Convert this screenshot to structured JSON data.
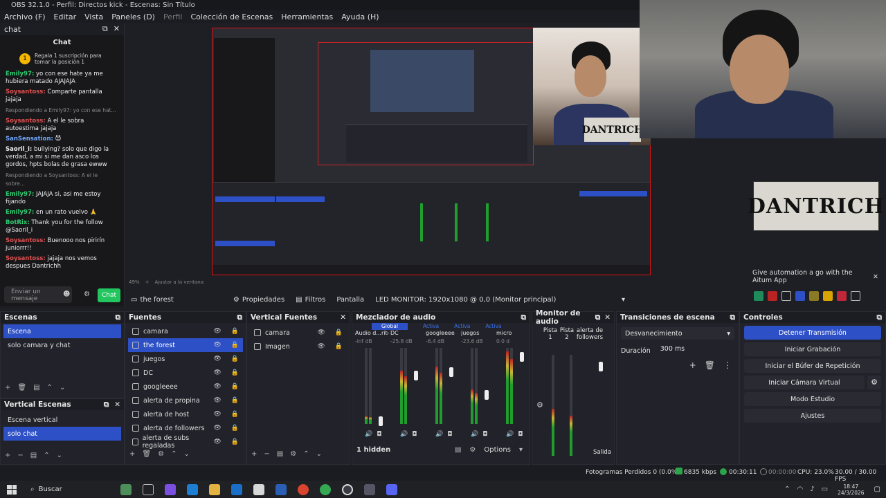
{
  "window": {
    "title": "OBS 32.1.0 - Perfil: Directos kick - Escenas: Sin Título",
    "menu": [
      "Archivo (F)",
      "Editar",
      "Vista",
      "Paneles (D)",
      "Perfil",
      "Colección de Escenas",
      "Herramientas",
      "Ayuda (H)"
    ]
  },
  "chat": {
    "dock_title": "chat",
    "panel_title": "Chat",
    "gift_banner": "Regala 1 suscripción para tomar la posición 1",
    "messages": [
      {
        "user": "Emily97:",
        "text": " yo con ese hate ya me hubiera matado AJAJAJA",
        "color": "green"
      },
      {
        "user": "Soysantoss:",
        "text": " Comparte pantalla jajaja",
        "color": "red"
      },
      {
        "reply": "Respondiendo a Emily97: yo con ese hat..."
      },
      {
        "user": "Soysantoss:",
        "text": " A el le sobra autoestima jajaja",
        "color": "red"
      },
      {
        "user": "SanSensation:",
        "text": " 😈",
        "color": "blue"
      },
      {
        "user": "Saoril_i:",
        "text": " bullying? solo que digo la verdad, a mi si me dan asco los gordos, hpts bolas de grasa ewww",
        "color": "white"
      },
      {
        "reply": "Respondiendo a Soysantoss: A el le sobre..."
      },
      {
        "user": "Emily97:",
        "text": " JAJAJA si, asi me estoy fijando",
        "color": "green"
      },
      {
        "user": "Emily97:",
        "text": " en un rato vuelvo 🙏",
        "color": "green"
      },
      {
        "user": "BotRix:",
        "text": " Thank you for the follow @Saoril_i",
        "color": "green"
      },
      {
        "user": "Soysantoss:",
        "text": " Buenooo nos pirirín juniorrr!!",
        "color": "red"
      },
      {
        "user": "Soysantoss:",
        "text": " jajaja nos vemos despues Dantrichh",
        "color": "red"
      }
    ],
    "input_placeholder": "Enviar un mensaje",
    "send_label": "Chat"
  },
  "preview": {
    "zoom": "49%",
    "fit_label": "Ajustar a la ventana",
    "logo_text": "DANTRICH",
    "aitum_text": "Give automation a go with the Aitum App"
  },
  "context_bar": {
    "source": "the forest",
    "properties": "Propiedades",
    "filters": "Filtros",
    "display_label": "Pantalla",
    "display_value": "LED MONITOR: 1920x1080 @ 0,0 (Monitor principal)"
  },
  "scenes": {
    "title": "Escenas",
    "items": [
      "Escena",
      "solo camara y chat"
    ],
    "selected": 0
  },
  "vertical_scenes": {
    "title": "Vertical Escenas",
    "items": [
      "Escena vertical",
      "solo chat"
    ],
    "selected": 1
  },
  "sources": {
    "title": "Fuentes",
    "items": [
      "camara",
      "the forest",
      "juegos",
      "DC",
      "googleeee",
      "alerta de propina",
      "alerta de host",
      "alerta de followers",
      "alerta de subs regaladas"
    ],
    "selected": 1
  },
  "vertical_sources": {
    "title": "Vertical Fuentes",
    "items": [
      "camara",
      "Imagen"
    ]
  },
  "mixer": {
    "title": "Mezclador de audio",
    "tabs": [
      "Global",
      "Activa",
      "Activa",
      "Activa"
    ],
    "channels": [
      {
        "name": "Audio d...ritorio",
        "db": "-inf dB",
        "level": 0.1
      },
      {
        "name": "DC",
        "db": "-25.8 dB",
        "level": 0.7
      },
      {
        "name": "googleeee",
        "db": "-6.4 dB",
        "level": 0.75
      },
      {
        "name": "juegos",
        "db": "-23.6 dB",
        "level": 0.45
      },
      {
        "name": "micro",
        "db": "0.0 d",
        "level": 0.95
      }
    ],
    "hidden": "1 hidden",
    "options": "Options"
  },
  "monitor": {
    "title": "Monitor de audio",
    "cols": [
      "Pista 1",
      "Pista 2",
      "alerta de followers"
    ],
    "output": "Salida"
  },
  "transitions": {
    "title": "Transiciones de escena",
    "selected": "Desvanecimiento",
    "duration_label": "Duración",
    "duration_value": "300 ms"
  },
  "controls": {
    "title": "Controles",
    "buttons": [
      "Detener Transmisión",
      "Iniciar Grabación",
      "Iniciar el Búfer de Repetición",
      "Iniciar Cámara Virtual",
      "Modo Estudio",
      "Ajustes"
    ]
  },
  "status": {
    "dropped": "Fotogramas Perdidos 0 (0.0%)",
    "bitrate": "6835 kbps",
    "live_time": "00:30:11",
    "rec_time": "00:00:00",
    "cpu": "CPU: 23.0%",
    "fps": "30.00 / 30.00 FPS"
  },
  "taskbar": {
    "search": "Buscar",
    "time": "18:47",
    "date": "24/3/2026"
  },
  "colors": {
    "accent": "#2d50c6",
    "live_red": "#d11111",
    "kick_green": "#22c55e"
  }
}
